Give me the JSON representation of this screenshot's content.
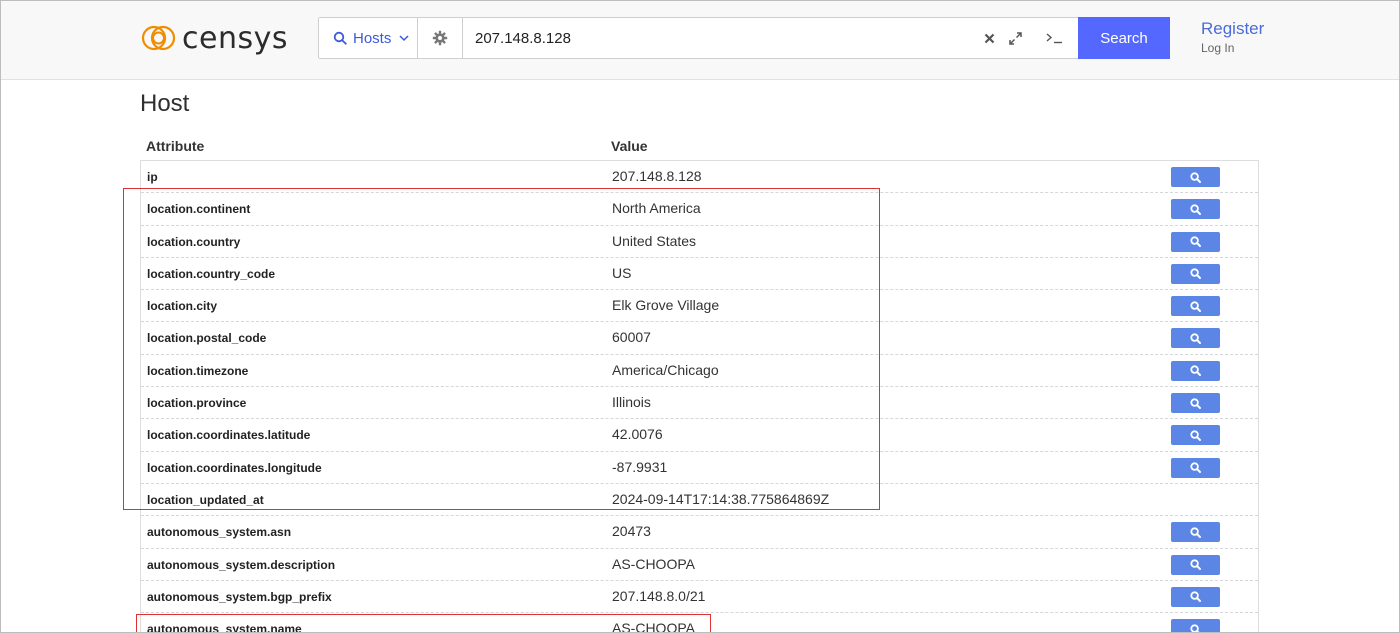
{
  "header": {
    "logo_text": "censys",
    "search_type": "Hosts",
    "query_value": "207.148.8.128",
    "search_button": "Search",
    "register": "Register",
    "login": "Log In",
    "accent_color": "#5468ff"
  },
  "page": {
    "title": "Host",
    "columns": {
      "attribute": "Attribute",
      "value": "Value"
    }
  },
  "rows": [
    {
      "attr": "ip",
      "value": "207.148.8.128",
      "has_search": true
    },
    {
      "attr": "location.continent",
      "value": "North America",
      "has_search": true
    },
    {
      "attr": "location.country",
      "value": "United States",
      "has_search": true
    },
    {
      "attr": "location.country_code",
      "value": "US",
      "has_search": true
    },
    {
      "attr": "location.city",
      "value": "Elk Grove Village",
      "has_search": true
    },
    {
      "attr": "location.postal_code",
      "value": "60007",
      "has_search": true
    },
    {
      "attr": "location.timezone",
      "value": "America/Chicago",
      "has_search": true
    },
    {
      "attr": "location.province",
      "value": "Illinois",
      "has_search": true
    },
    {
      "attr": "location.coordinates.latitude",
      "value": "42.0076",
      "has_search": true
    },
    {
      "attr": "location.coordinates.longitude",
      "value": "-87.9931",
      "has_search": true
    },
    {
      "attr": "location_updated_at",
      "value": "2024-09-14T17:14:38.775864869Z",
      "has_search": false
    },
    {
      "attr": "autonomous_system.asn",
      "value": "20473",
      "has_search": true
    },
    {
      "attr": "autonomous_system.description",
      "value": "AS-CHOOPA",
      "has_search": true
    },
    {
      "attr": "autonomous_system.bgp_prefix",
      "value": "207.148.8.0/21",
      "has_search": true
    },
    {
      "attr": "autonomous_system.name",
      "value": "AS-CHOOPA",
      "has_search": true
    }
  ]
}
